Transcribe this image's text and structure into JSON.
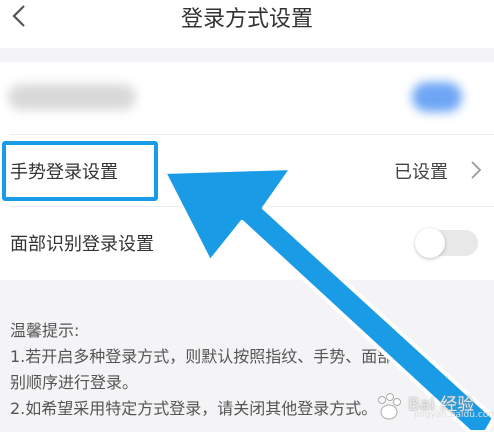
{
  "header": {
    "title": "登录方式设置"
  },
  "settings": {
    "gesture": {
      "label": "手势登录设置",
      "value": "已设置"
    },
    "face": {
      "label": "面部识别登录设置",
      "enabled": false
    }
  },
  "tips": {
    "title": "温馨提示:",
    "line1": "1.若开启多种登录方式，则默认按照指纹、手势、面部识",
    "line2": "别顺序进行登录。",
    "line3": "2.如希望采用特定方式登录，请关闭其他登录方式。"
  },
  "watermark": {
    "text": "Bai 经验",
    "sub": "jingyan.baidu.com"
  },
  "colors": {
    "highlight": "#1a9be6",
    "arrow": "#1a9be6"
  }
}
